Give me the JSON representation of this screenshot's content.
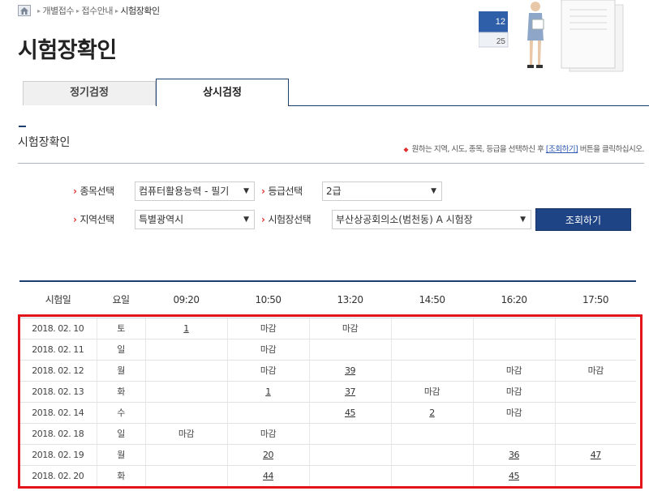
{
  "breadcrumb": {
    "items": [
      "개별접수",
      "접수안내"
    ],
    "current": "시험장확인",
    "separator": "▸"
  },
  "page_title": "시험장확인",
  "illustration": {
    "calendar_numbers": [
      "12",
      "25"
    ]
  },
  "tabs": [
    {
      "label": "정기검정",
      "active": false
    },
    {
      "label": "상시검정",
      "active": true
    }
  ],
  "section": {
    "title": "시험장확인",
    "note_prefix": "원하는 지역, 시도, 종목, 등급을 선택하신 후",
    "note_link": "[조회하기]",
    "note_suffix": "버튼을 클릭하십시오."
  },
  "filters": {
    "subject_label": "종목선택",
    "subject_value": "컴퓨터활용능력 - 필기",
    "grade_label": "등급선택",
    "grade_value": "2급",
    "region_label": "지역선택",
    "region_value": "특별광역시",
    "site_label": "시험장선택",
    "site_value": "부산상공회의소(범천동) A 시험장",
    "search_button": "조회하기"
  },
  "table": {
    "headers": [
      "시험일",
      "요일",
      "09:20",
      "10:50",
      "13:20",
      "14:50",
      "16:20",
      "17:50"
    ],
    "rows": [
      [
        "2018. 02. 10",
        "토",
        "1",
        "마감",
        "마감",
        "",
        "",
        ""
      ],
      [
        "2018. 02. 11",
        "일",
        "",
        "마감",
        "",
        "",
        "",
        ""
      ],
      [
        "2018. 02. 12",
        "월",
        "",
        "마감",
        "39",
        "",
        "마감",
        "마감"
      ],
      [
        "2018. 02. 13",
        "화",
        "",
        "1",
        "37",
        "마감",
        "마감",
        ""
      ],
      [
        "2018. 02. 14",
        "수",
        "",
        "",
        "45",
        "2",
        "마감",
        ""
      ],
      [
        "2018. 02. 18",
        "일",
        "마감",
        "마감",
        "",
        "",
        "",
        ""
      ],
      [
        "2018. 02. 19",
        "월",
        "",
        "20",
        "",
        "",
        "36",
        "47"
      ],
      [
        "2018. 02. 20",
        "화",
        "",
        "44",
        "",
        "",
        "45",
        ""
      ]
    ]
  },
  "colors": {
    "accent": "#1d3f6e",
    "button": "#1f4486",
    "closed": "#e23232",
    "highlight": "#e2141c"
  }
}
